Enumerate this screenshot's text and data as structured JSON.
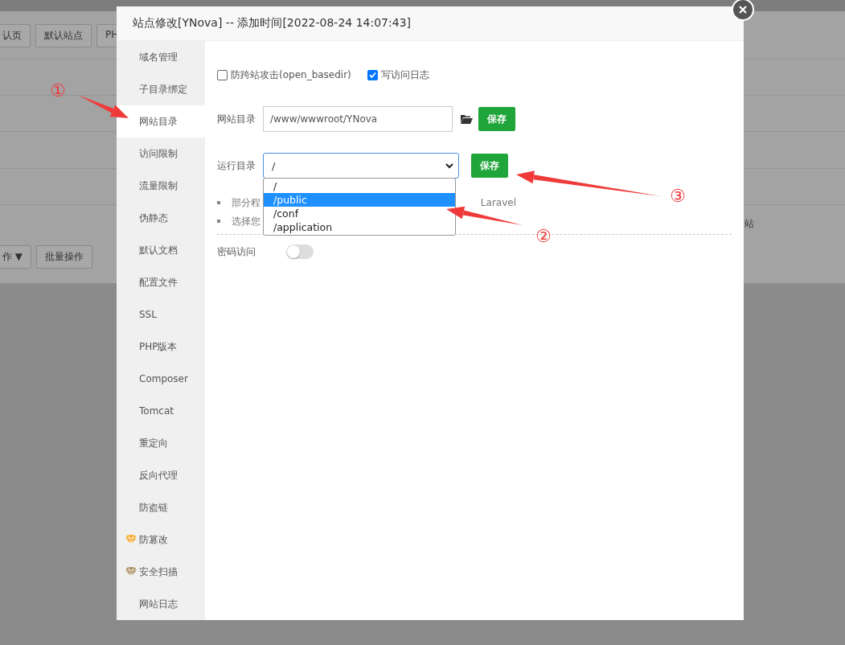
{
  "background_page": {
    "buttons": [
      "认页",
      "默认站点",
      "PH"
    ],
    "batch_select": "作",
    "batch_caret": "▼",
    "batch_button": "批量操作",
    "side_text": "站"
  },
  "dialog": {
    "title": "站点修改[YNova] -- 添加时间[2022-08-24 14:07:43]",
    "sidebar": [
      {
        "label": "域名管理",
        "selected": false
      },
      {
        "label": "子目录绑定",
        "selected": false
      },
      {
        "label": "网站目录",
        "selected": true
      },
      {
        "label": "访问限制",
        "selected": false
      },
      {
        "label": "流量限制",
        "selected": false
      },
      {
        "label": "伪静态",
        "selected": false
      },
      {
        "label": "默认文档",
        "selected": false
      },
      {
        "label": "配置文件",
        "selected": false
      },
      {
        "label": "SSL",
        "selected": false
      },
      {
        "label": "PHP版本",
        "selected": false
      },
      {
        "label": "Composer",
        "selected": false
      },
      {
        "label": "Tomcat",
        "selected": false
      },
      {
        "label": "重定向",
        "selected": false
      },
      {
        "label": "反向代理",
        "selected": false
      },
      {
        "label": "防盗链",
        "selected": false
      },
      {
        "label": "防篡改",
        "selected": false,
        "color": "#f5a623"
      },
      {
        "label": "安全扫描",
        "selected": false,
        "color": "#a88b5a"
      },
      {
        "label": "网站日志",
        "selected": false
      }
    ],
    "checkboxes": [
      {
        "label": "防跨站攻击(open_basedir)",
        "checked": false
      },
      {
        "label": "写访问日志",
        "checked": true
      }
    ],
    "site_dir": {
      "label": "网站目录",
      "value": "/www/wwwroot/YNova",
      "button": "保存"
    },
    "run_dir": {
      "label": "运行目录",
      "value": "/",
      "button": "保存",
      "expanded": true,
      "options": [
        {
          "label": "/",
          "highlighted": false
        },
        {
          "label": "/public",
          "highlighted": true
        },
        {
          "label": "/conf",
          "highlighted": false
        },
        {
          "label": "/application",
          "highlighted": false
        }
      ]
    },
    "hints": [
      {
        "before": "部分程",
        "after": "Laravel"
      },
      {
        "before": "选择您"
      }
    ],
    "password_access": {
      "label": "密码访问",
      "on": false
    }
  },
  "annotations": [
    "①",
    "②",
    "③"
  ]
}
